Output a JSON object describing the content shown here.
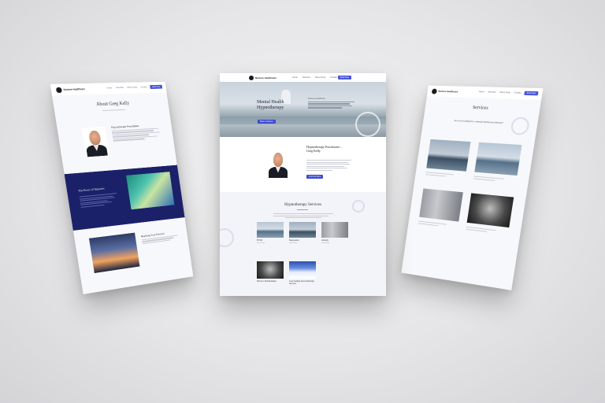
{
  "brand": {
    "name": "Nurture Healthcare",
    "accent": "#3d4bd1",
    "navy": "#1b2169"
  },
  "nav": {
    "links": [
      "Home",
      "Services",
      "About Greg",
      "Contact",
      "Book"
    ],
    "cta": "Book Now"
  },
  "center": {
    "hero_title_line1": "Mental Health",
    "hero_title_line2": "Hypnotherapy",
    "hero_blurb": "Nurture Healthcare",
    "hero_button": "Book a Session",
    "bio_title_line1": "Hypnotherapy Practitioner –",
    "bio_title_line2": "Greg Kelly",
    "bio_button": "Find Out More",
    "services_title": "Hypnotherapy Services",
    "services": [
      {
        "title": "PTSD",
        "meta": "Learn More"
      },
      {
        "title": "Depression",
        "meta": "Learn More"
      },
      {
        "title": "Anxiety",
        "meta": "Learn More"
      },
      {
        "title": "Divorce Relationships",
        "meta": "Learn More"
      },
      {
        "title": "Goal Setting And Achieving Success",
        "meta": "Learn More"
      }
    ]
  },
  "left": {
    "title": "About Greg Kelly",
    "bio_heading": "Hypnotherapy Practitioner",
    "band_heading": "The Power of Hypnosis",
    "lower_heading": "Realising Your Potential"
  },
  "right": {
    "title": "Services",
    "intro": "Are you looking for a mental health practitioner?"
  }
}
